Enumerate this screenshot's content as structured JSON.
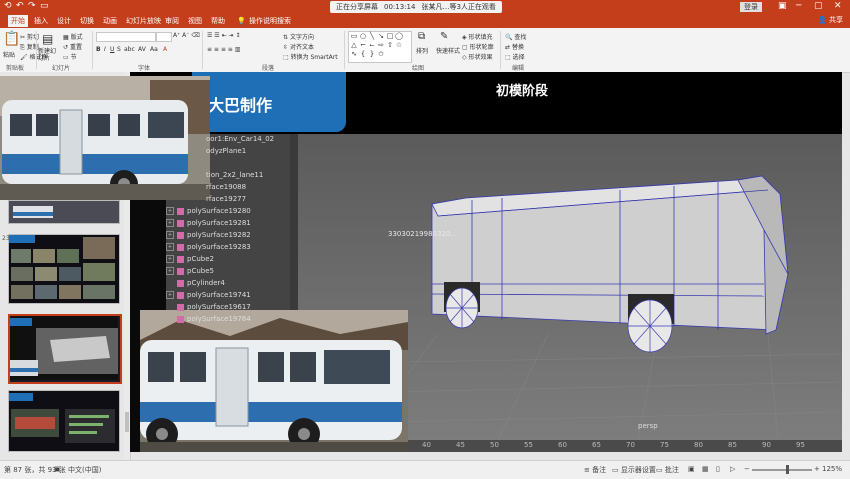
{
  "titlebar": {
    "share_status": "正在分享屏幕",
    "share_time": "00:13:14",
    "viewers": "张某凡…等3人正在观看",
    "login_label": "登录"
  },
  "tabs": [
    "开始",
    "插入",
    "设计",
    "切换",
    "动画",
    "幻灯片放映",
    "审阅",
    "视图",
    "帮助",
    "操作说明搜索"
  ],
  "share_label": "共享",
  "ribbon": {
    "clipboard": {
      "cut": "剪切",
      "copy": "复制",
      "format_painter": "格式刷",
      "paste": "粘贴",
      "group": "剪贴板"
    },
    "slides": {
      "new_slide": "新建幻灯片",
      "layout": "版式",
      "reset": "重置",
      "section": "节",
      "group": "幻灯片"
    },
    "font": {
      "group": "字体"
    },
    "paragraph": {
      "text_direction": "文字方向",
      "align_text": "对齐文本",
      "smartart": "转换为 SmartArt",
      "group": "段落"
    },
    "drawing": {
      "arrange": "排列",
      "quick_styles": "快速样式",
      "shape_fill": "形状填充",
      "shape_outline": "形状轮廓",
      "shape_effects": "形状效果",
      "group": "绘图"
    },
    "editing": {
      "find": "查找",
      "replace": "替换",
      "select": "选择",
      "group": "编辑"
    }
  },
  "thumbnails": [
    {
      "num": ""
    },
    {
      "num": "23"
    },
    {
      "num": ""
    },
    {
      "num": ""
    }
  ],
  "slide": {
    "title": "大巴制作",
    "stage": "初模阶段"
  },
  "outliner": {
    "rows": [
      {
        "label": "oor1:Env_Car14_02",
        "expand": false
      },
      {
        "label": "odyzPlane1",
        "expand": false
      },
      {
        "label": "",
        "expand": false
      },
      {
        "label": "tion_2x2_lane11",
        "expand": false
      },
      {
        "label": "rface19088",
        "expand": false
      },
      {
        "label": "rface19277",
        "expand": false
      },
      {
        "label": "polySurface19280",
        "expand": true
      },
      {
        "label": "polySurface19281",
        "expand": true
      },
      {
        "label": "polySurface19282",
        "expand": true
      },
      {
        "label": "polySurface19283",
        "expand": true
      },
      {
        "label": "pCube2",
        "expand": true
      },
      {
        "label": "pCube5",
        "expand": true
      },
      {
        "label": "pCylinder4",
        "expand": false
      },
      {
        "label": "polySurface19741",
        "expand": true
      },
      {
        "label": "polySurface19617",
        "expand": false
      },
      {
        "label": "polySurface19764",
        "expand": false
      }
    ]
  },
  "viewport": {
    "camera": "persp",
    "ghost_text": "33030219980320..."
  },
  "timeline": [
    "40",
    "45",
    "50",
    "55",
    "60",
    "65",
    "70",
    "75",
    "80",
    "85",
    "90",
    "95"
  ],
  "statusbar": {
    "slide_pos": "第 87 张，共 93 张",
    "language": "中文(中国)",
    "notes": "备注",
    "display": "显示器设置",
    "comments": "批注",
    "zoom": "125%"
  },
  "colors": {
    "accent": "#c43e1c",
    "title_tab": "#1f6fb6",
    "bus_blue": "#2d6fae"
  }
}
